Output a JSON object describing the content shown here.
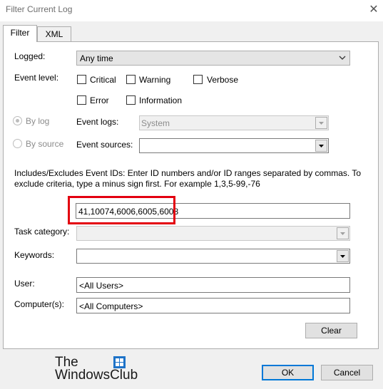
{
  "window": {
    "title": "Filter Current Log",
    "close_glyph": "✕"
  },
  "tabs": [
    {
      "label": "Filter"
    },
    {
      "label": "XML"
    }
  ],
  "logged": {
    "label": "Logged:",
    "value": "Any time"
  },
  "event_level": {
    "label": "Event level:",
    "options": [
      {
        "label": "Critical",
        "checked": false
      },
      {
        "label": "Warning",
        "checked": false
      },
      {
        "label": "Verbose",
        "checked": false
      },
      {
        "label": "Error",
        "checked": false
      },
      {
        "label": "Information",
        "checked": false
      }
    ]
  },
  "source_mode": {
    "by_log": {
      "label": "By log",
      "selected": true
    },
    "by_source": {
      "label": "By source",
      "selected": false
    }
  },
  "event_logs": {
    "label": "Event logs:",
    "value": "System"
  },
  "event_sources": {
    "label": "Event sources:",
    "value": ""
  },
  "event_ids": {
    "description": "Includes/Excludes Event IDs: Enter ID numbers and/or ID ranges separated by commas. To exclude criteria, type a minus sign first. For example 1,3,5-99,-76",
    "value": "41,10074,6006,6005,6008"
  },
  "task_category": {
    "label": "Task category:",
    "value": ""
  },
  "keywords": {
    "label": "Keywords:",
    "value": ""
  },
  "user": {
    "label": "User:",
    "value": "<All Users>"
  },
  "computers": {
    "label": "Computer(s):",
    "value": "<All Computers>"
  },
  "buttons": {
    "clear": "Clear",
    "ok": "OK",
    "cancel": "Cancel"
  },
  "watermark": {
    "line1": "The",
    "line2": "WindowsClub"
  },
  "colors": {
    "highlight": "#e3000f",
    "accent": "#0078d7",
    "logo_blue": "#1e73c8"
  }
}
